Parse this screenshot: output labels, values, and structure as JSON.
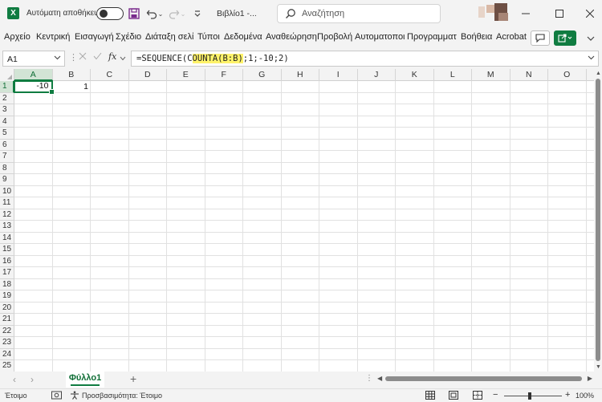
{
  "titlebar": {
    "app_logo": "X",
    "autosave_label": "Αυτόματη αποθήκευση",
    "autosave_on": false,
    "doc_title": "Βιβλίο1 -...",
    "search_placeholder": "Αναζήτηση",
    "icons": [
      "save-icon",
      "undo-icon",
      "redo-icon",
      "customize-icon",
      "search-icon",
      "minimize-icon",
      "maximize-icon",
      "close-icon"
    ]
  },
  "ribbon": {
    "tabs": [
      "Αρχείο",
      "Κεντρική",
      "Εισαγωγή",
      "Σχέδιο",
      "Διάταξη σελίδ",
      "Τύποι",
      "Δεδομένα",
      "Αναθεώρηση",
      "Προβολή",
      "Αυτοματοποι",
      "Προγραμματ",
      "Βοήθεια",
      "Acrobat"
    ]
  },
  "formula_bar": {
    "name_box": "A1",
    "fx": "fx",
    "formula_pre": "=SEQUENCE(C",
    "formula_highlight": "OUNTA(B:B)",
    "formula_post": ";1;-10;2)"
  },
  "grid": {
    "columns": [
      "A",
      "B",
      "C",
      "D",
      "E",
      "F",
      "G",
      "H",
      "I",
      "J",
      "K",
      "L",
      "M",
      "N",
      "O"
    ],
    "rows": [
      "1",
      "2",
      "3",
      "4",
      "5",
      "6",
      "7",
      "8",
      "9",
      "10",
      "11",
      "12",
      "13",
      "14",
      "15",
      "16",
      "17",
      "18",
      "19",
      "20",
      "21",
      "22",
      "23",
      "24",
      "25"
    ],
    "selected_column": "A",
    "selected_row": "1",
    "cells": {
      "A1": "-10",
      "B1": "1"
    }
  },
  "sheets": {
    "tabs": [
      "Φύλλο1"
    ],
    "add_label": "+"
  },
  "status": {
    "ready": "Έτοιμο",
    "accessibility": "Προσβασιμότητα: Έτοιμο",
    "zoom": "100%",
    "zoom_minus": "−",
    "zoom_plus": "+"
  },
  "colors": {
    "accent": "#107c41",
    "selection_header": "#d2e4d5",
    "highlight": "#fff36a"
  }
}
